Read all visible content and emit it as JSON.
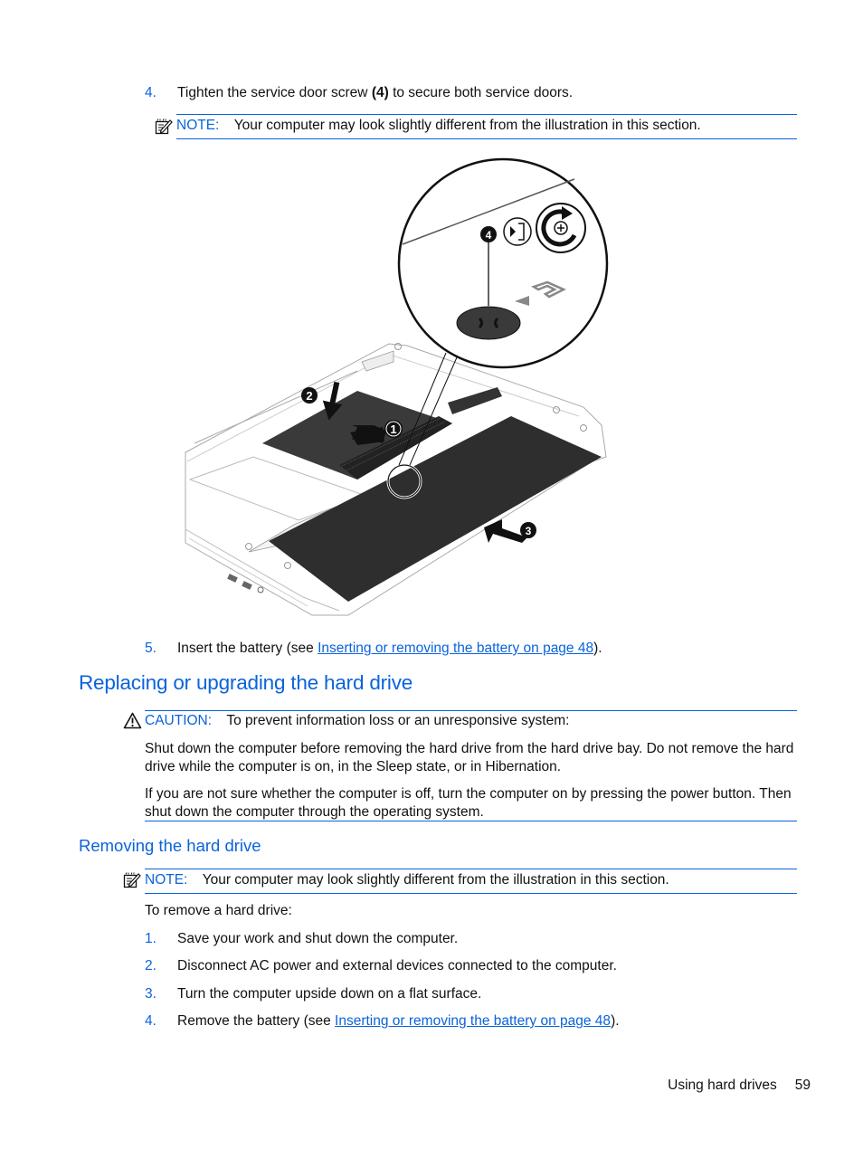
{
  "steps_top": [
    {
      "number": "4.",
      "text_before": "Tighten the service door screw ",
      "bold": "(4)",
      "text_after": " to secure both service doors."
    }
  ],
  "note_top": {
    "icon": "note-pencil-icon",
    "label": "NOTE:",
    "text": "Your computer may look slightly different from the illustration in this section."
  },
  "illustration": {
    "description": "Laptop underside with service doors and battery",
    "callouts": [
      "1",
      "2",
      "3",
      "4"
    ]
  },
  "step5": {
    "number": "5.",
    "text_before": "Insert the battery (see ",
    "link": "Inserting or removing the battery on page 48",
    "text_after": ")."
  },
  "section": {
    "title": "Replacing or upgrading the hard drive",
    "caution": {
      "icon": "warning-triangle-icon",
      "label": "CAUTION:",
      "text": "To prevent information loss or an unresponsive system:",
      "paragraphs": [
        "Shut down the computer before removing the hard drive from the hard drive bay. Do not remove the hard drive while the computer is on, in the Sleep state, or in Hibernation.",
        "If you are not sure whether the computer is off, turn the computer on by pressing the power button. Then shut down the computer through the operating system."
      ]
    }
  },
  "subsection": {
    "title": "Removing the hard drive",
    "note": {
      "icon": "note-pencil-icon",
      "label": "NOTE:",
      "text": "Your computer may look slightly different from the illustration in this section."
    },
    "intro": "To remove a hard drive:",
    "steps": [
      {
        "number": "1.",
        "text": "Save your work and shut down the computer."
      },
      {
        "number": "2.",
        "text": "Disconnect AC power and external devices connected to the computer."
      },
      {
        "number": "3.",
        "text": "Turn the computer upside down on a flat surface."
      },
      {
        "number": "4.",
        "text_before": "Remove the battery (see ",
        "link": "Inserting or removing the battery on page 48",
        "text_after": ")."
      }
    ]
  },
  "footer": {
    "section_name": "Using hard drives",
    "page_number": "59"
  },
  "colors": {
    "accent": "#0a63dc",
    "text": "#111111"
  }
}
